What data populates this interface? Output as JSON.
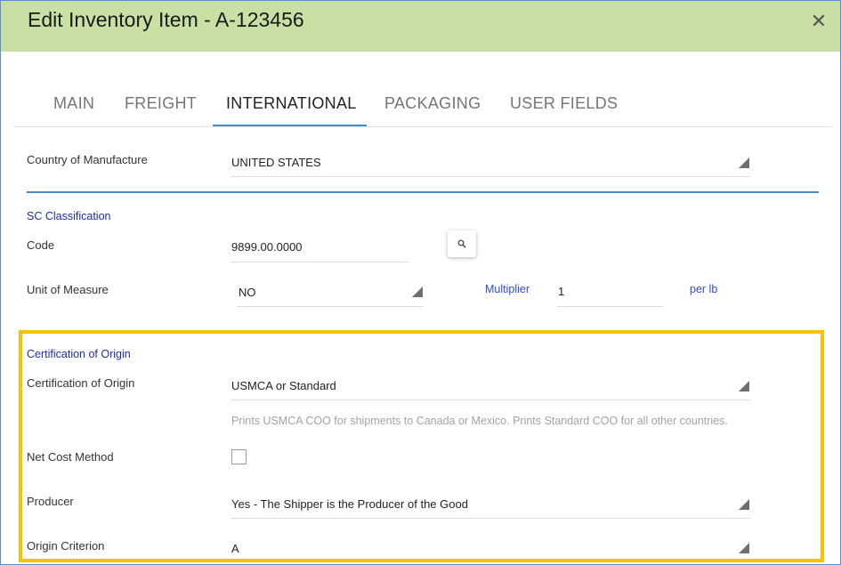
{
  "dialog": {
    "title": "Edit Inventory Item - A-123456",
    "close_symbol": "✕"
  },
  "tabs": [
    {
      "label": "MAIN",
      "active": false
    },
    {
      "label": "FREIGHT",
      "active": false
    },
    {
      "label": "INTERNATIONAL",
      "active": true
    },
    {
      "label": "PACKAGING",
      "active": false
    },
    {
      "label": "USER FIELDS",
      "active": false
    }
  ],
  "country": {
    "label": "Country of Manufacture",
    "value": "UNITED STATES"
  },
  "sc_classification": {
    "section_title": "SC Classification",
    "code_label": "Code",
    "code_value": "9899.00.0000",
    "uom_label": "Unit of Measure",
    "uom_value": "NO",
    "multiplier_label": "Multiplier",
    "multiplier_value": "1",
    "per_unit": "per lb"
  },
  "certification": {
    "section_title": "Certification of Origin",
    "cert_label": "Certification of Origin",
    "cert_value": "USMCA or Standard",
    "cert_hint": "Prints USMCA COO for shipments to Canada or Mexico. Prints Standard COO for all other countries.",
    "net_cost_label": "Net Cost Method",
    "net_cost_checked": false,
    "producer_label": "Producer",
    "producer_value": "Yes - The Shipper is the Producer of the Good",
    "origin_label": "Origin Criterion",
    "origin_value": "A"
  },
  "colors": {
    "title_bar": "#c8e0a4",
    "accent_blue": "#3b8dd6",
    "highlight": "#f5c400",
    "section_title": "#1d2ea0"
  }
}
